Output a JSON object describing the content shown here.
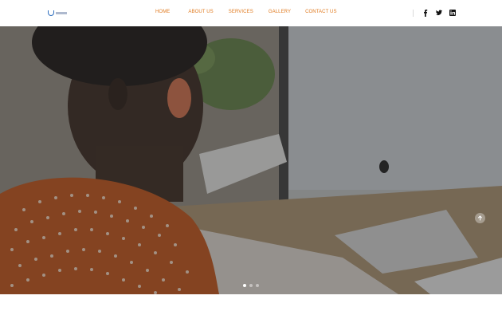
{
  "nav": {
    "items": [
      {
        "label": "HOME"
      },
      {
        "label": "ABOUT US"
      },
      {
        "label": "SERVICES"
      },
      {
        "label": "GALLERY"
      },
      {
        "label": "CONTACT US"
      }
    ]
  },
  "social": {
    "icons": [
      "facebook-icon",
      "twitter-icon",
      "linkedin-icon"
    ]
  },
  "colors": {
    "accent": "#e07a1f",
    "logo_blue": "#2f6fbf"
  },
  "hero": {
    "slides_total": 3,
    "active_slide": 1
  }
}
